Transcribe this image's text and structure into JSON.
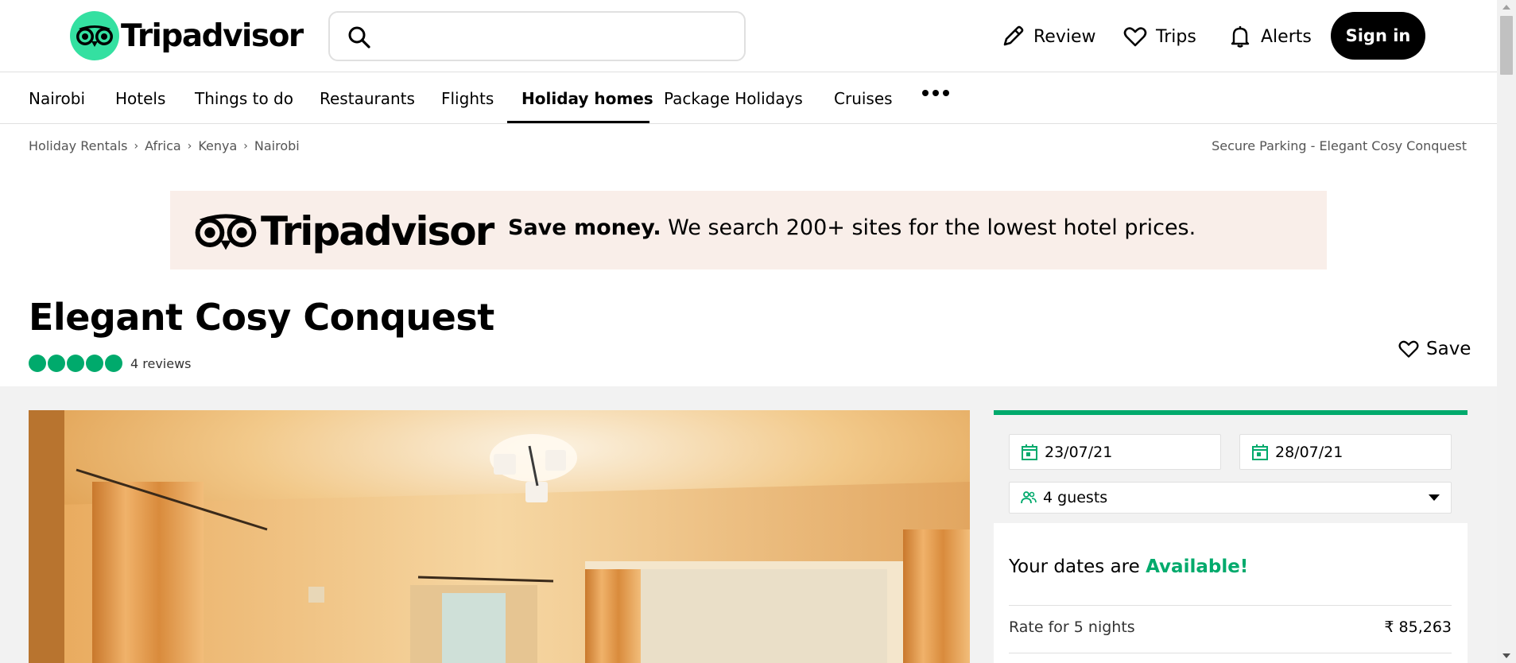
{
  "header": {
    "logo_text": "Tripadvisor",
    "search": {
      "value": "",
      "placeholder": ""
    },
    "nav": {
      "review": "Review",
      "trips": "Trips",
      "alerts": "Alerts",
      "sign_in": "Sign in"
    }
  },
  "subnav": {
    "items": [
      "Nairobi",
      "Hotels",
      "Things to do",
      "Restaurants",
      "Flights",
      "Holiday homes",
      "Package Holidays",
      "Cruises"
    ],
    "active": "Holiday homes"
  },
  "breadcrumb": {
    "items": [
      "Holiday Rentals",
      "Africa",
      "Kenya",
      "Nairobi"
    ],
    "right": "Secure Parking - Elegant Cosy Conquest"
  },
  "banner": {
    "logo_text": "Tripadvisor",
    "bold": "Save money.",
    "text": " We search 200+ sites for the lowest hotel prices."
  },
  "listing": {
    "title": "Elegant Cosy Conquest",
    "rating": 5,
    "reviews": "4 reviews",
    "save": "Save"
  },
  "booking": {
    "check_in": "23/07/21",
    "check_out": "28/07/21",
    "guests": "4 guests",
    "availability_prefix": "Your dates are ",
    "availability_status": "Available!",
    "rate_label": "Rate for 5 nights",
    "rate_value": "₹ 85,263"
  },
  "colors": {
    "brand_green": "#34e0a1",
    "rating_green": "#00aa6c",
    "banner_bg": "#f9eee9",
    "signin_bg": "#000000"
  }
}
